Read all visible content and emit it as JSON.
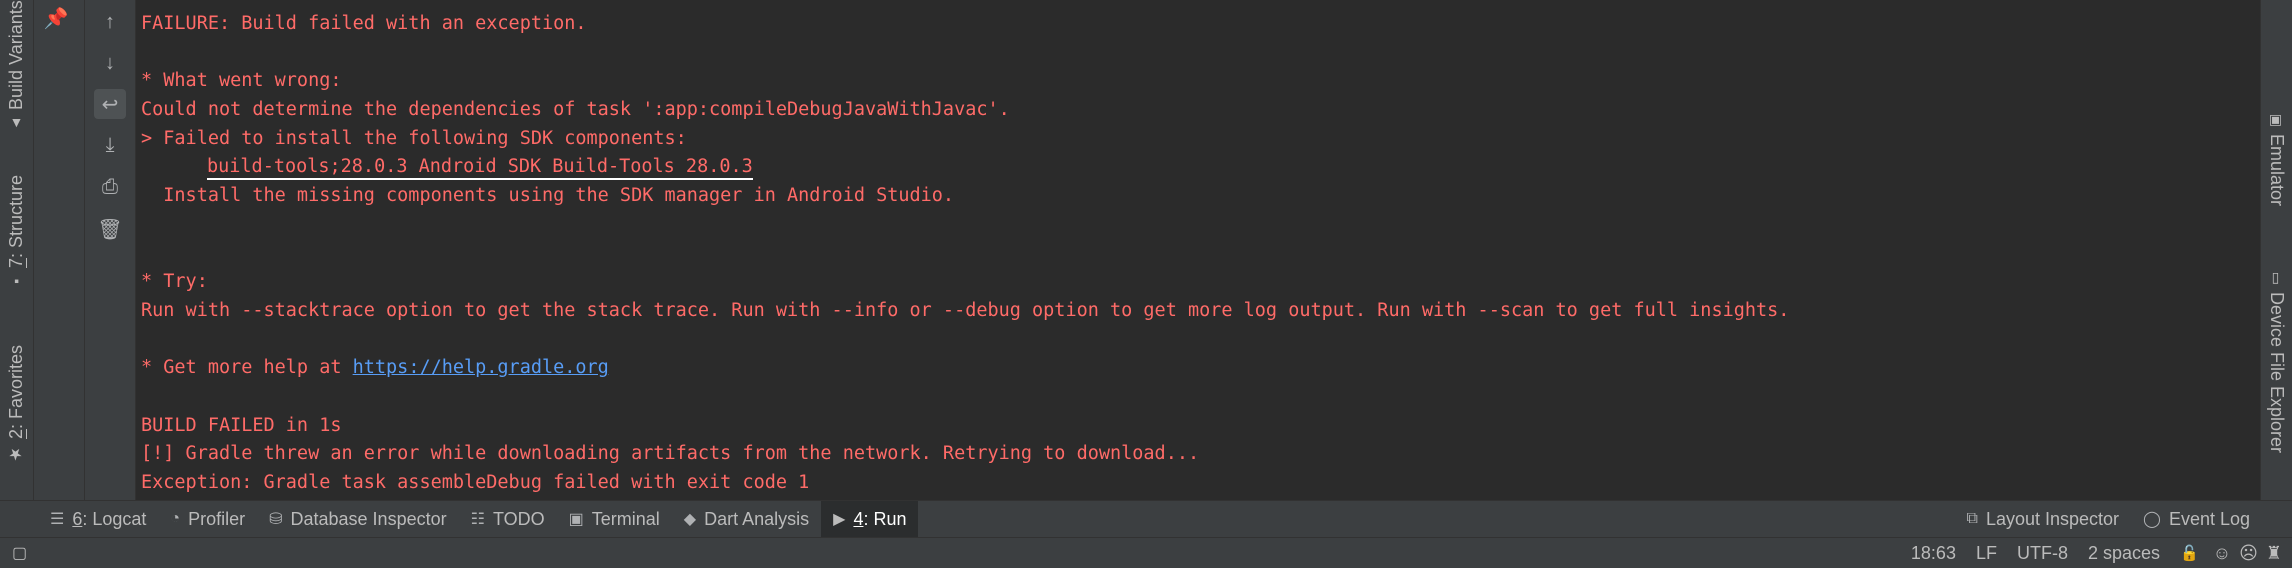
{
  "left_tabs": {
    "build_variants": "Build Variants",
    "structure_prefix": "7",
    "structure_label": ": Structure",
    "favorites_prefix": "2",
    "favorites_label": ": Favorites"
  },
  "right_tabs": {
    "emulator": "Emulator",
    "device_file_explorer": "Device File Explorer"
  },
  "console": {
    "line1": "FAILURE: Build failed with an exception.",
    "line2": "",
    "line3": "* What went wrong:",
    "line4": "Could not determine the dependencies of task ':app:compileDebugJavaWithJavac'.",
    "line5": "> Failed to install the following SDK components:",
    "line6": "build-tools;28.0.3 Android SDK Build-Tools 28.0.3",
    "line7": "  Install the missing components using the SDK manager in Android Studio.",
    "line8": "",
    "line9": "",
    "line10": "* Try:",
    "line11": "Run with --stacktrace option to get the stack trace. Run with --info or --debug option to get more log output. Run with --scan to get full insights.",
    "line12": "",
    "line13_prefix": "* Get more help at ",
    "line13_link": "https://help.gradle.org",
    "line14": "",
    "line15": "BUILD FAILED in 1s",
    "line16": "[!] Gradle threw an error while downloading artifacts from the network. Retrying to download...",
    "line17": "Exception: Gradle task assembleDebug failed with exit code 1"
  },
  "bottom_tabs": {
    "logcat_num": "6",
    "logcat_label": ": Logcat",
    "profiler": "Profiler",
    "database_inspector": "Database Inspector",
    "todo": "TODO",
    "terminal": "Terminal",
    "dart_analysis": "Dart Analysis",
    "run_num": "4",
    "run_label": ": Run",
    "layout_inspector": "Layout Inspector",
    "event_log": "Event Log"
  },
  "status": {
    "position": "18:63",
    "line_sep": "LF",
    "encoding": "UTF-8",
    "indent": "2 spaces"
  }
}
